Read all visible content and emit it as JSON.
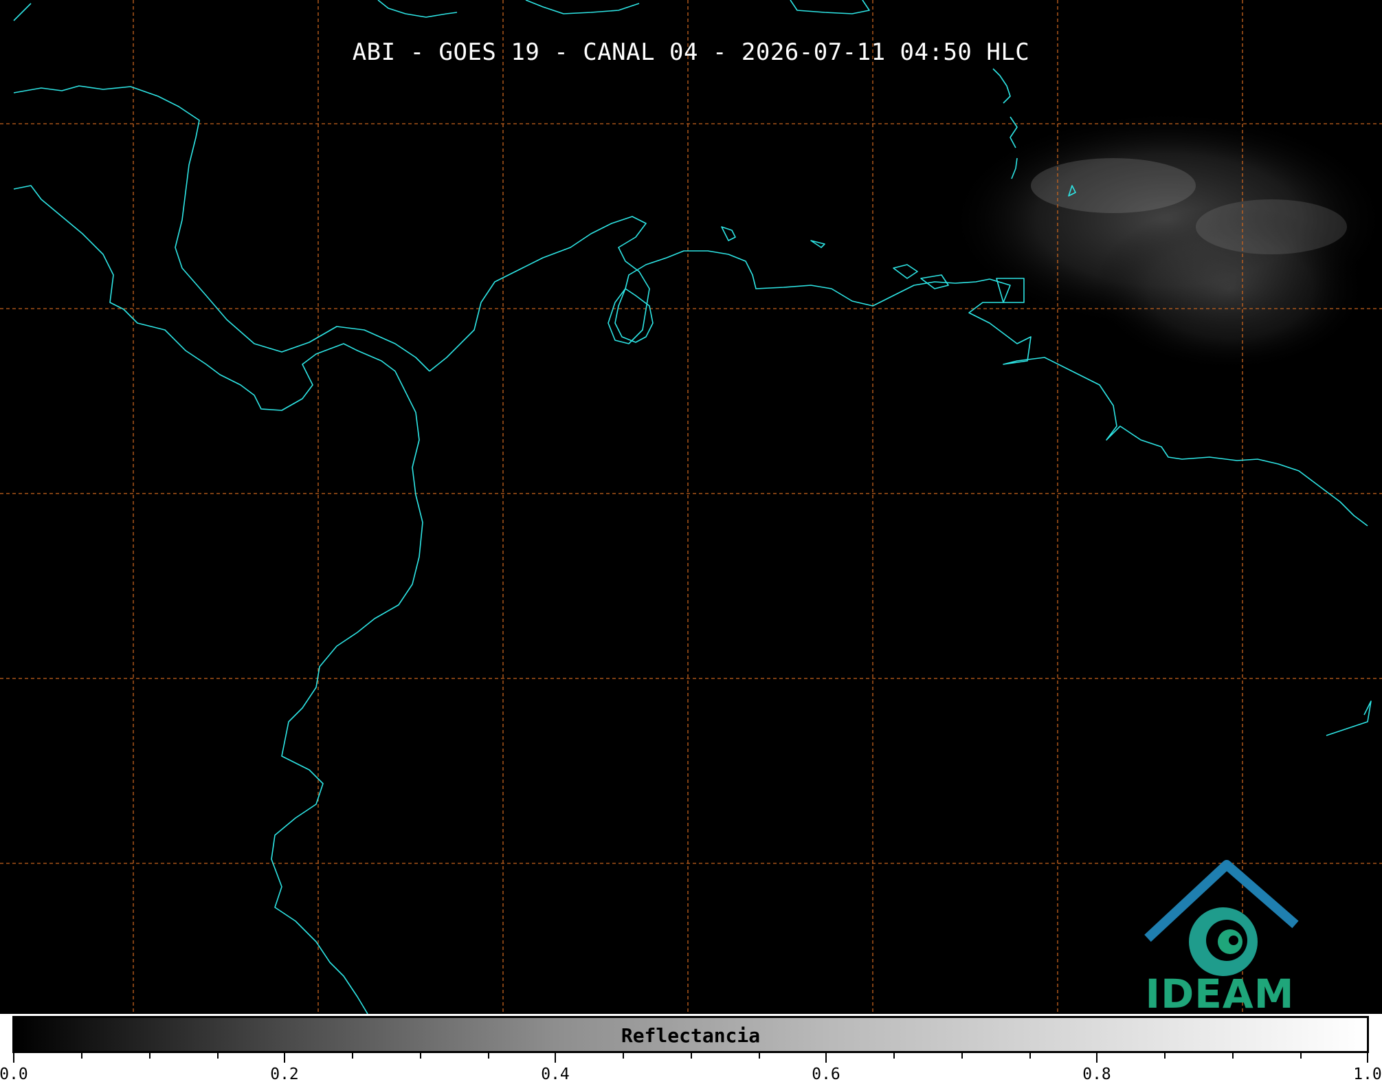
{
  "title": "ABI - GOES 19 - CANAL 04 - 2026-07-11 04:50 HLC",
  "colors": {
    "background": "#000000",
    "coastline": "#2ee6e6",
    "graticule": "#c8641e",
    "logo_green": "#1fa67a",
    "logo_blue": "#1f7fb0"
  },
  "logo": {
    "text": "IDEAM"
  },
  "colorbar": {
    "label": "Reflectancia",
    "range": [
      0.0,
      1.0
    ],
    "cmap": "grayscale",
    "tick_labels": [
      "0.0",
      "0.2",
      "0.4",
      "0.6",
      "0.8",
      "1.0"
    ]
  }
}
